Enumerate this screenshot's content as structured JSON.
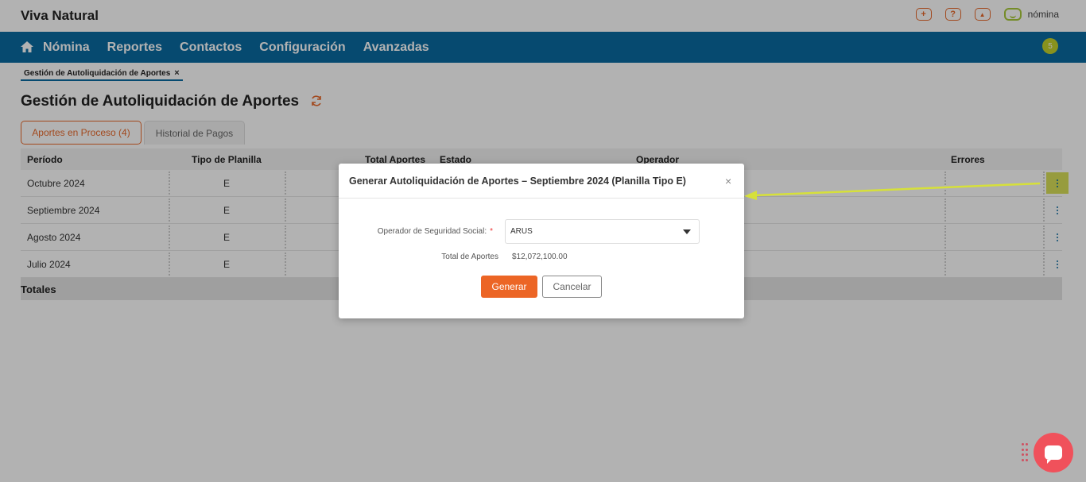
{
  "app": {
    "company": "Viva Natural",
    "logo_text": "nómina",
    "notification_count": "5"
  },
  "top_icons": [
    {
      "icon": "plus-icon",
      "glyph": "+"
    },
    {
      "icon": "help-icon",
      "glyph": "?"
    },
    {
      "icon": "user-icon",
      "glyph": "▲"
    }
  ],
  "nav": {
    "items": [
      "Nómina",
      "Reportes",
      "Contactos",
      "Configuración",
      "Avanzadas"
    ]
  },
  "breadcrumb": {
    "label": "Gestión de Autoliquidación de Aportes",
    "close": "×"
  },
  "page": {
    "title": "Gestión de Autoliquidación de Aportes"
  },
  "tabs": {
    "active": "Aportes en Proceso (4)",
    "inactive": "Historial de Pagos"
  },
  "table": {
    "headers": {
      "periodo": "Período",
      "tipo": "Tipo de Planilla",
      "total": "Total Aportes",
      "estado": "Estado",
      "operador": "Operador",
      "errores": "Errores"
    },
    "rows": [
      {
        "periodo": "Octubre 2024",
        "tipo": "E"
      },
      {
        "periodo": "Septiembre 2024",
        "tipo": "E"
      },
      {
        "periodo": "Agosto 2024",
        "tipo": "E"
      },
      {
        "periodo": "Julio 2024",
        "tipo": "E"
      }
    ],
    "footer": "Totales"
  },
  "modal": {
    "title": "Generar Autoliquidación de Aportes – Septiembre 2024 (Planilla Tipo E)",
    "close": "×",
    "operator_label": "Operador de Seguridad Social:",
    "required_mark": "*",
    "operator_value": "ARUS",
    "total_label": "Total de Aportes",
    "total_value": "$12,072,100.00",
    "generate_label": "Generar",
    "cancel_label": "Cancelar"
  },
  "colors": {
    "nav_bg": "#0a6aa1",
    "accent": "#ec6525",
    "highlight": "#d9e05a",
    "arrow": "#d6e03a"
  }
}
